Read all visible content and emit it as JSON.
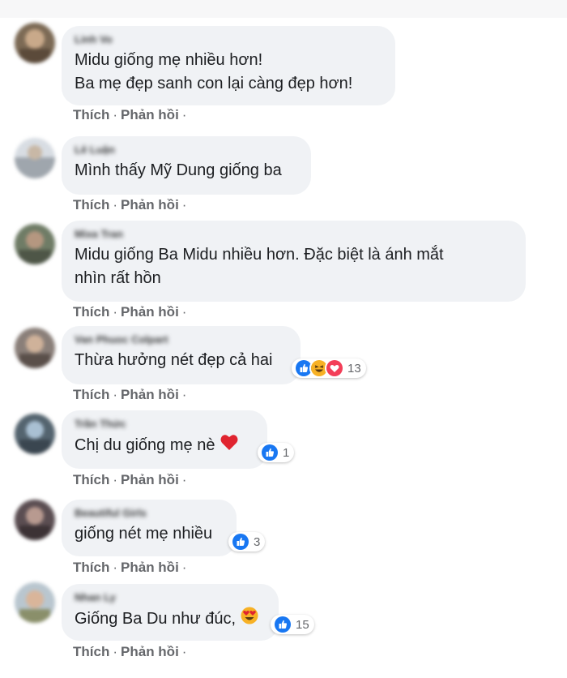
{
  "colors": {
    "bubble": "#f0f2f5",
    "text": "#1c1e21",
    "meta": "#65676b",
    "like_blue": "#1877f2",
    "love_red": "#f33e58",
    "haha_yellow": "#f7b125"
  },
  "actions": {
    "like": "Thích",
    "separator": "·",
    "reply": "Phản hồi",
    "trailing": "·"
  },
  "comments": [
    {
      "author": "Linh Vo",
      "lines": [
        "Midu giống mẹ nhiều hơn!",
        "Ba mẹ đẹp sanh con lại càng đẹp hơn!"
      ],
      "reactions": null
    },
    {
      "author": "Lê Luận",
      "lines": [
        "Mình thấy Mỹ Dung giống ba"
      ],
      "reactions": null
    },
    {
      "author": "Mixa Tran",
      "lines": [
        "Midu giống Ba Midu nhiều hơn. Đặc biệt là ánh mắt",
        "nhìn rất hồn"
      ],
      "reactions": null
    },
    {
      "author": "Van Phuoc Colpart",
      "lines": [
        "Thừa hưởng nét đẹp cả hai"
      ],
      "reactions": {
        "icons": [
          "like-icon",
          "haha-icon",
          "love-icon"
        ],
        "count": "13"
      }
    },
    {
      "author": "Trần Thức",
      "lines": [
        "Chị du giống mẹ nè"
      ],
      "inline_emoji": "heart",
      "reactions": {
        "icons": [
          "like-icon"
        ],
        "count": "1"
      }
    },
    {
      "author": "Beautiful Girls",
      "lines": [
        "giống nét mẹ nhiều"
      ],
      "reactions": {
        "icons": [
          "like-icon"
        ],
        "count": "3"
      }
    },
    {
      "author": "Nhan Ly",
      "lines": [
        "Giống Ba Du như đúc,"
      ],
      "inline_emoji": "heart-eyes",
      "reactions": {
        "icons": [
          "like-icon"
        ],
        "count": "15"
      }
    }
  ]
}
